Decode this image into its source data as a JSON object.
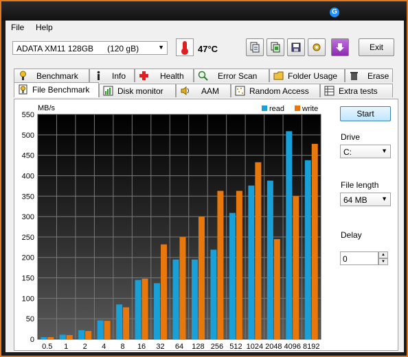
{
  "menu": {
    "file": "File",
    "help": "Help"
  },
  "toolbar": {
    "drive": "ADATA XM11 128GB",
    "drive_size": "(120 gB)",
    "temperature": "47°C",
    "exit_label": "Exit",
    "tool_icons": [
      "copy-text-icon",
      "copy-screenshot-icon",
      "save-icon",
      "options-icon",
      "download-icon"
    ]
  },
  "tabs_row1": [
    {
      "label": "Benchmark",
      "icon": "benchmark-icon"
    },
    {
      "label": "Info",
      "icon": "info-icon"
    },
    {
      "label": "Health",
      "icon": "health-icon"
    },
    {
      "label": "Error Scan",
      "icon": "error-scan-icon"
    },
    {
      "label": "Folder Usage",
      "icon": "folder-icon"
    },
    {
      "label": "Erase",
      "icon": "erase-icon"
    }
  ],
  "tabs_row2": [
    {
      "label": "File Benchmark",
      "icon": "file-benchmark-icon",
      "active": true
    },
    {
      "label": "Disk monitor",
      "icon": "disk-monitor-icon"
    },
    {
      "label": "AAM",
      "icon": "aam-icon"
    },
    {
      "label": "Random Access",
      "icon": "random-access-icon"
    },
    {
      "label": "Extra tests",
      "icon": "extra-tests-icon"
    }
  ],
  "controls": {
    "start_label": "Start",
    "drive_label": "Drive",
    "drive_value": "C:",
    "file_length_label": "File length",
    "file_length_value": "64 MB",
    "delay_label": "Delay",
    "delay_value": "0"
  },
  "colors": {
    "read": "#1aa0d8",
    "write": "#e8780c",
    "border": "#e07a20"
  },
  "chart_data": {
    "type": "bar",
    "ylabel": "MB/s",
    "ylim": [
      0,
      550
    ],
    "yticks": [
      0,
      50,
      100,
      150,
      200,
      250,
      300,
      350,
      400,
      450,
      500,
      550
    ],
    "grid": true,
    "legend_position": "top-right",
    "categories": [
      "0.5",
      "1",
      "2",
      "4",
      "8",
      "16",
      "32",
      "64",
      "128",
      "256",
      "512",
      "1024",
      "2048",
      "4096",
      "8192"
    ],
    "series": [
      {
        "name": "read",
        "color": "#1aa0d8",
        "values": [
          5,
          11,
          22,
          46,
          85,
          145,
          137,
          195,
          195,
          219,
          309,
          376,
          388,
          509,
          438
        ]
      },
      {
        "name": "write",
        "color": "#e8780c",
        "values": [
          5,
          10,
          20,
          45,
          78,
          148,
          232,
          250,
          300,
          363,
          363,
          433,
          245,
          350,
          478
        ]
      }
    ]
  }
}
